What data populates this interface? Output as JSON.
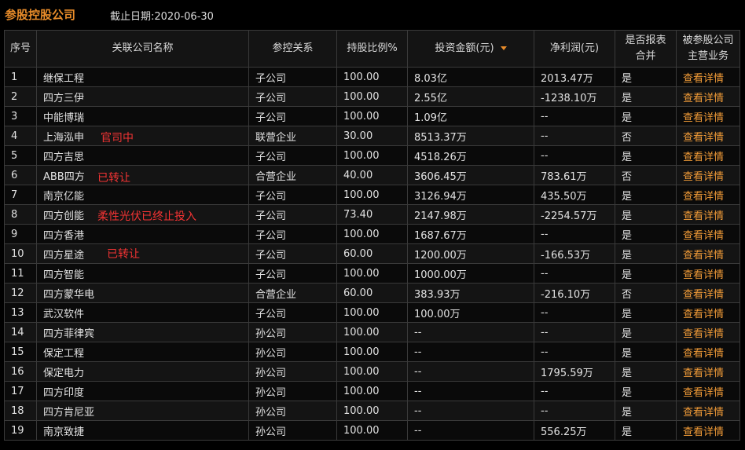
{
  "header": {
    "title": "参股控股公司",
    "deadline": "截止日期:2020-06-30"
  },
  "table": {
    "columns": {
      "index": "序号",
      "name": "关联公司名称",
      "relation": "参控关系",
      "share": "持股比例%",
      "investment": "投资金额(元)",
      "profit": "净利润(元)",
      "consolidated_line1": "是否报表",
      "consolidated_line2": "合并",
      "business_line1": "被参股公司",
      "business_line2": "主营业务"
    },
    "rows": [
      {
        "index": "1",
        "name": "继保工程",
        "relation": "子公司",
        "share": "100.00",
        "investment": "8.03亿",
        "profit": "2013.47万",
        "consolidated": "是",
        "detail": "查看详情"
      },
      {
        "index": "2",
        "name": "四方三伊",
        "relation": "子公司",
        "share": "100.00",
        "investment": "2.55亿",
        "profit": "-1238.10万",
        "consolidated": "是",
        "detail": "查看详情"
      },
      {
        "index": "3",
        "name": "中能博瑞",
        "relation": "子公司",
        "share": "100.00",
        "investment": "1.09亿",
        "profit": "--",
        "consolidated": "是",
        "detail": "查看详情"
      },
      {
        "index": "4",
        "name": "上海泓申",
        "relation": "联营企业",
        "share": "30.00",
        "investment": "8513.37万",
        "profit": "--",
        "consolidated": "否",
        "detail": "查看详情"
      },
      {
        "index": "5",
        "name": "四方吉思",
        "relation": "子公司",
        "share": "100.00",
        "investment": "4518.26万",
        "profit": "--",
        "consolidated": "是",
        "detail": "查看详情"
      },
      {
        "index": "6",
        "name": "ABB四方",
        "relation": "合营企业",
        "share": "40.00",
        "investment": "3606.45万",
        "profit": "783.61万",
        "consolidated": "否",
        "detail": "查看详情"
      },
      {
        "index": "7",
        "name": "南京亿能",
        "relation": "子公司",
        "share": "100.00",
        "investment": "3126.94万",
        "profit": "435.50万",
        "consolidated": "是",
        "detail": "查看详情"
      },
      {
        "index": "8",
        "name": "四方创能",
        "relation": "子公司",
        "share": "73.40",
        "investment": "2147.98万",
        "profit": "-2254.57万",
        "consolidated": "是",
        "detail": "查看详情"
      },
      {
        "index": "9",
        "name": "四方香港",
        "relation": "子公司",
        "share": "100.00",
        "investment": "1687.67万",
        "profit": "--",
        "consolidated": "是",
        "detail": "查看详情"
      },
      {
        "index": "10",
        "name": "四方星途",
        "relation": "子公司",
        "share": "60.00",
        "investment": "1200.00万",
        "profit": "-166.53万",
        "consolidated": "是",
        "detail": "查看详情"
      },
      {
        "index": "11",
        "name": "四方智能",
        "relation": "子公司",
        "share": "100.00",
        "investment": "1000.00万",
        "profit": "--",
        "consolidated": "是",
        "detail": "查看详情"
      },
      {
        "index": "12",
        "name": "四方蒙华电",
        "relation": "合营企业",
        "share": "60.00",
        "investment": "383.93万",
        "profit": "-216.10万",
        "consolidated": "否",
        "detail": "查看详情"
      },
      {
        "index": "13",
        "name": "武汉软件",
        "relation": "子公司",
        "share": "100.00",
        "investment": "100.00万",
        "profit": "--",
        "consolidated": "是",
        "detail": "查看详情"
      },
      {
        "index": "14",
        "name": "四方菲律宾",
        "relation": "孙公司",
        "share": "100.00",
        "investment": "--",
        "profit": "--",
        "consolidated": "是",
        "detail": "查看详情"
      },
      {
        "index": "15",
        "name": "保定工程",
        "relation": "孙公司",
        "share": "100.00",
        "investment": "--",
        "profit": "--",
        "consolidated": "是",
        "detail": "查看详情"
      },
      {
        "index": "16",
        "name": "保定电力",
        "relation": "孙公司",
        "share": "100.00",
        "investment": "--",
        "profit": "1795.59万",
        "consolidated": "是",
        "detail": "查看详情"
      },
      {
        "index": "17",
        "name": "四方印度",
        "relation": "孙公司",
        "share": "100.00",
        "investment": "--",
        "profit": "--",
        "consolidated": "是",
        "detail": "查看详情"
      },
      {
        "index": "18",
        "name": "四方肯尼亚",
        "relation": "孙公司",
        "share": "100.00",
        "investment": "--",
        "profit": "--",
        "consolidated": "是",
        "detail": "查看详情"
      },
      {
        "index": "19",
        "name": "南京致捷",
        "relation": "孙公司",
        "share": "100.00",
        "investment": "--",
        "profit": "556.25万",
        "consolidated": "是",
        "detail": "查看详情"
      }
    ]
  },
  "annotations": {
    "row4": "官司中",
    "row6": "已转让",
    "row8": "柔性光伏已终止投入",
    "row10": "已转让"
  },
  "colors": {
    "accent": "#e88c2a",
    "link": "#f29c38",
    "annotation": "#f23333",
    "background": "#000000"
  }
}
